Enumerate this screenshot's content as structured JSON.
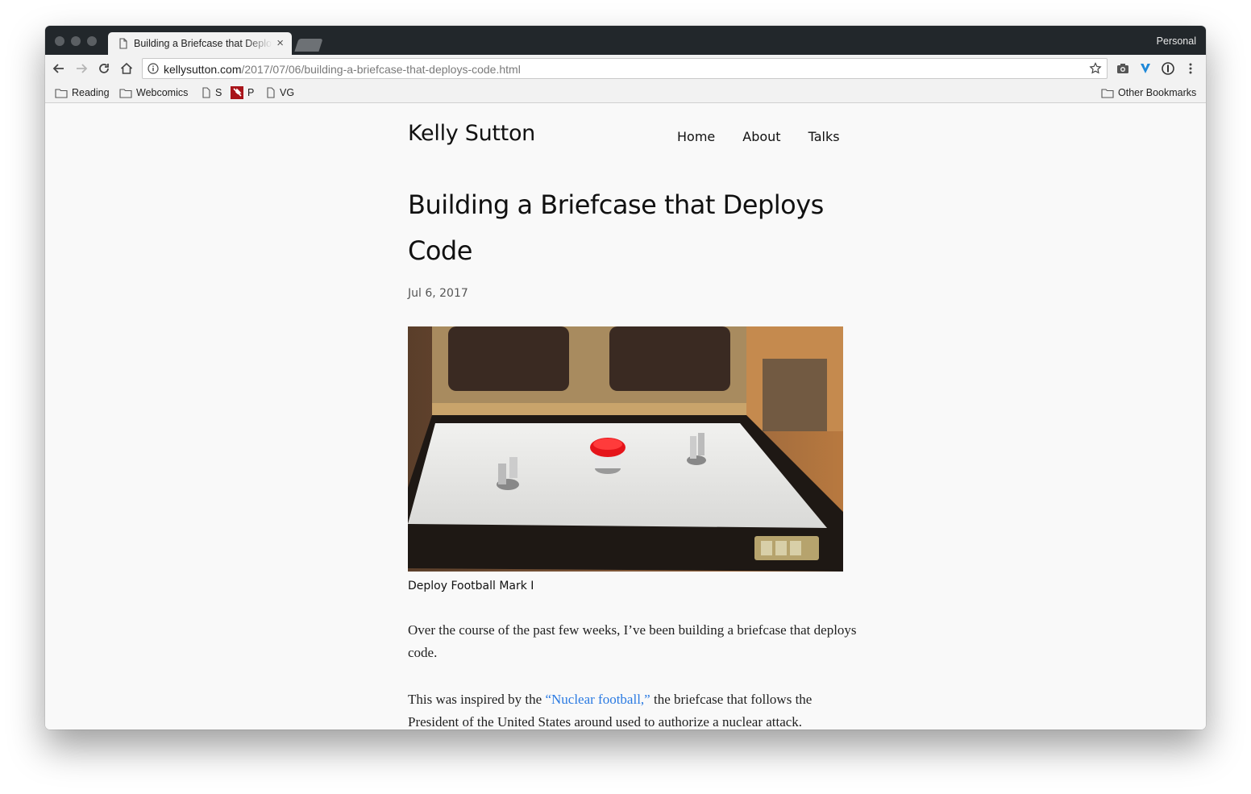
{
  "browser": {
    "tab": {
      "title": "Building a Briefcase that Deploys Code",
      "close_glyph": "×"
    },
    "profile": "Personal",
    "address": {
      "domain": "kellysutton.com",
      "path": "/2017/07/06/building-a-briefcase-that-deploys-code.html"
    },
    "bookmarks": {
      "left": [
        {
          "label": "Reading",
          "icon": "folder-icon"
        },
        {
          "label": "Webcomics",
          "icon": "folder-icon"
        },
        {
          "label": "S",
          "icon": "page-icon"
        },
        {
          "label": "P",
          "icon": "pinboard-icon"
        },
        {
          "label": "VG",
          "icon": "page-icon"
        }
      ],
      "right": {
        "label": "Other Bookmarks",
        "icon": "folder-icon"
      }
    }
  },
  "site": {
    "title": "Kelly Sutton",
    "nav": [
      "Home",
      "About",
      "Talks"
    ]
  },
  "post": {
    "title": "Building a Briefcase that Deploys Code",
    "date": "Jul 6, 2017",
    "image_caption": "Deploy Football Mark I",
    "p1": "Over the course of the past few weeks, I’ve been building a briefcase that deploys code.",
    "p2_before": "This was inspired by the ",
    "p2_link": "“Nuclear football,”",
    "p2_after": " the briefcase that follows the President of the United States around used to authorize a nuclear attack."
  },
  "colors": {
    "link": "#2a7ae2",
    "titlebar": "#22272b",
    "button_red": "#e5141a"
  }
}
